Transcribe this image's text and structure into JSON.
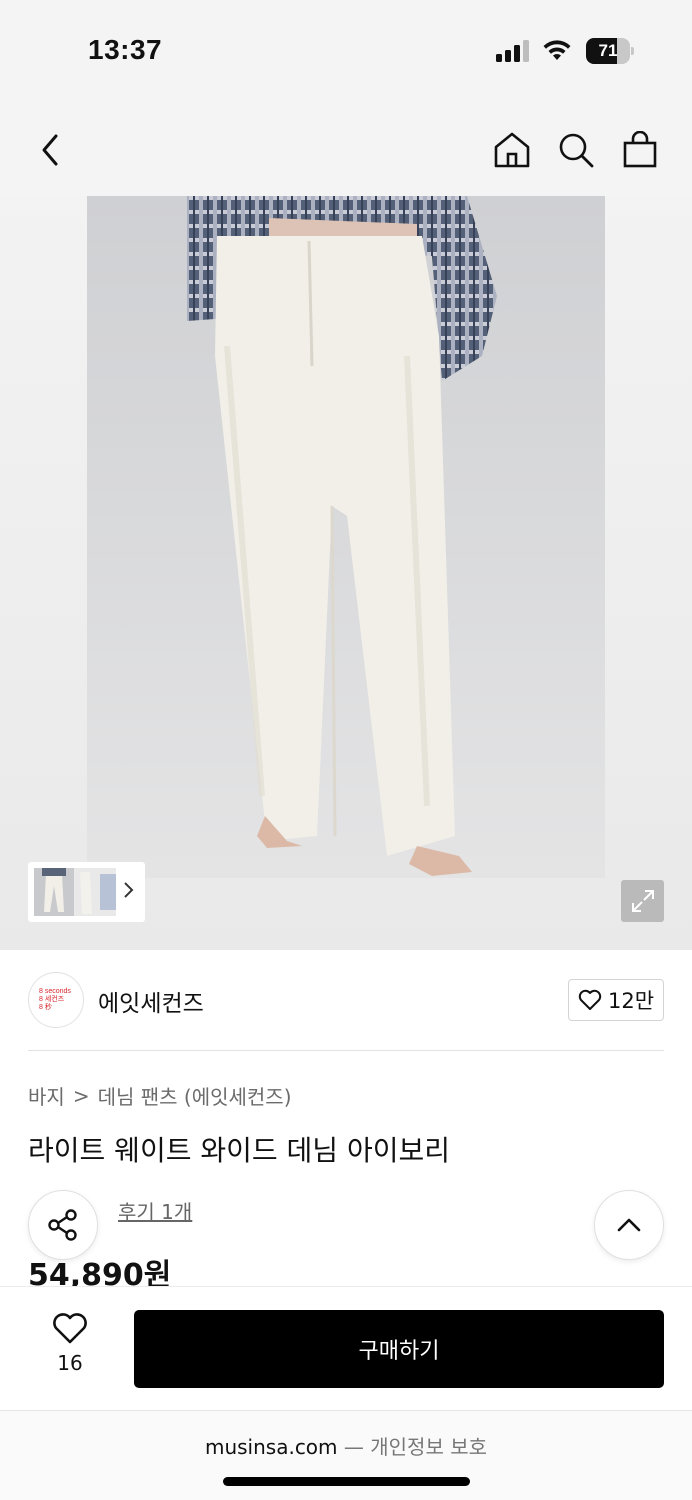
{
  "status_bar": {
    "time": "13:37",
    "battery_percent": "71",
    "battery_level": 0.71,
    "icons": [
      "cellular-signal-icon",
      "wifi-icon",
      "battery-icon"
    ]
  },
  "nav": {
    "icons": [
      "back-chevron-icon",
      "home-icon",
      "search-icon",
      "shopping-bag-icon"
    ]
  },
  "gallery": {
    "thumbnail_icon": "chevron-right-icon",
    "expand_icon": "expand-icon"
  },
  "brand": {
    "logo_lines": [
      "8 seconds",
      "8 세컨즈",
      "8 秒"
    ],
    "name": "에잇세컨즈",
    "like_count": "12만",
    "like_icon": "heart-icon"
  },
  "breadcrumb": {
    "category": "바지",
    "separator": ">",
    "subcategory": "데님 팬츠 (에잇세컨즈)"
  },
  "product": {
    "title": "라이트 웨이트 와이드 데님 아이보리",
    "review_text": "후기 1개",
    "price": "54,890원"
  },
  "floating": {
    "share_icon": "share-icon",
    "top_icon": "chevron-up-icon"
  },
  "bottom_bar": {
    "wish_count": "16",
    "buy_label": "구매하기"
  },
  "browser": {
    "domain": "musinsa.com",
    "separator": "—",
    "privacy": "개인정보 보호"
  },
  "colors": {
    "accent": "#000000",
    "brand_logo": "#d8262b"
  }
}
